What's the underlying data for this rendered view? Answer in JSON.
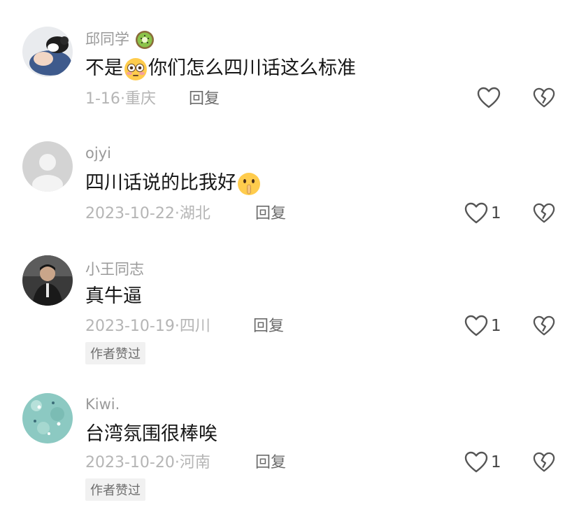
{
  "comments": [
    {
      "username": "邱同学",
      "text_before": "不是",
      "text_after": "你们怎么四川话这么标准",
      "date": "1-16",
      "location": "重庆",
      "reply_label": "回复",
      "likes": ""
    },
    {
      "username": "ojyi",
      "text_before": "四川话说的比我好",
      "text_after": "",
      "date": "2023-10-22",
      "location": "湖北",
      "reply_label": "回复",
      "likes": "1"
    },
    {
      "username": "小王同志",
      "text_before": "真牛逼",
      "text_after": "",
      "date": "2023-10-19",
      "location": "四川",
      "reply_label": "回复",
      "likes": "1",
      "badge": "作者赞过"
    },
    {
      "username": "Kiwi.",
      "text_before": "台湾氛围很棒唉",
      "text_after": "",
      "date": "2023-10-20",
      "location": "河南",
      "reply_label": "回复",
      "likes": "1",
      "badge": "作者赞过"
    }
  ],
  "meta_separator": "·"
}
